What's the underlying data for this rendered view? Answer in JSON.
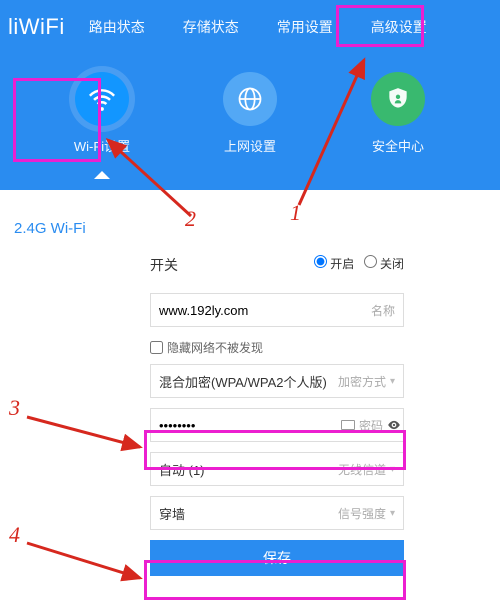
{
  "logo": "liWiFi",
  "nav": {
    "router_status": "路由状态",
    "storage_status": "存储状态",
    "common_settings": "常用设置",
    "advanced_settings": "高级设置"
  },
  "icons": {
    "wifi": {
      "label": "Wi-Fi设置"
    },
    "internet": {
      "label": "上网设置"
    },
    "security": {
      "label": "安全中心"
    }
  },
  "section_title": "2.4G Wi-Fi",
  "form": {
    "switch_label": "开关",
    "switch_on": "开启",
    "switch_off": "关闭",
    "ssid_value": "www.192ly.com",
    "ssid_suffix": "名称",
    "hide_ssid_label": "隐藏网络不被发现",
    "encryption_value": "混合加密(WPA/WPA2个人版)",
    "encryption_suffix": "加密方式",
    "password_value": "••••••••",
    "password_suffix": "密码",
    "channel_value": "自动 (1)",
    "channel_suffix": "无线信道",
    "signal_value": "穿墙",
    "signal_suffix": "信号强度",
    "save": "保存"
  },
  "annotations": {
    "n1": "1",
    "n2": "2",
    "n3": "3",
    "n4": "4"
  }
}
